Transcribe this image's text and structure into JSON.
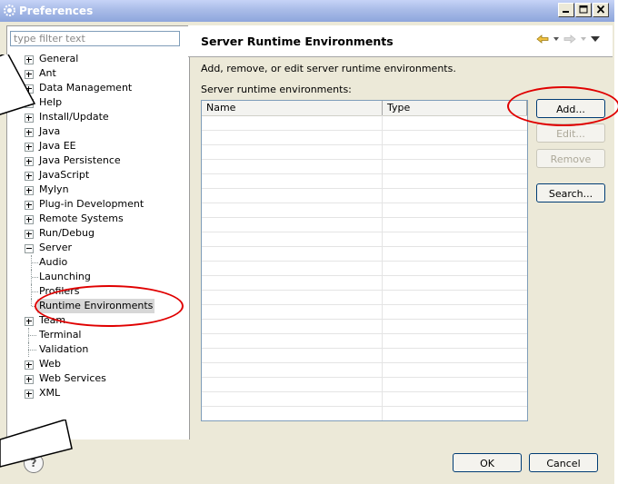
{
  "window": {
    "title": "Preferences",
    "controls": [
      "minimize",
      "maximize",
      "close"
    ]
  },
  "filter": {
    "placeholder": "type filter text"
  },
  "tree": [
    {
      "label": "General",
      "expandable": true
    },
    {
      "label": "Ant",
      "expandable": true
    },
    {
      "label": "Data Management",
      "expandable": true
    },
    {
      "label": "Help",
      "expandable": true
    },
    {
      "label": "Install/Update",
      "expandable": true
    },
    {
      "label": "Java",
      "expandable": true
    },
    {
      "label": "Java EE",
      "expandable": true
    },
    {
      "label": "Java Persistence",
      "expandable": true
    },
    {
      "label": "JavaScript",
      "expandable": true
    },
    {
      "label": "Mylyn",
      "expandable": true
    },
    {
      "label": "Plug-in Development",
      "expandable": true
    },
    {
      "label": "Remote Systems",
      "expandable": true
    },
    {
      "label": "Run/Debug",
      "expandable": true
    },
    {
      "label": "Server",
      "expandable": true,
      "expanded": true
    },
    {
      "label": "Audio",
      "child": true
    },
    {
      "label": "Launching",
      "child": true
    },
    {
      "label": "Profilers",
      "child": true
    },
    {
      "label": "Runtime Environments",
      "child": true,
      "selected": true
    },
    {
      "label": "Team",
      "expandable": true
    },
    {
      "label": "Terminal",
      "expandable": false
    },
    {
      "label": "Validation",
      "expandable": false
    },
    {
      "label": "Web",
      "expandable": true
    },
    {
      "label": "Web Services",
      "expandable": true
    },
    {
      "label": "XML",
      "expandable": true
    }
  ],
  "page": {
    "title": "Server Runtime Environments",
    "description": "Add, remove, or edit server runtime environments.",
    "table_label": "Server runtime environments:",
    "columns": [
      "Name",
      "Type"
    ]
  },
  "buttons": {
    "add": "Add...",
    "edit": "Edit...",
    "remove": "Remove",
    "search": "Search...",
    "ok": "OK",
    "cancel": "Cancel"
  },
  "help": {
    "glyph": "?"
  },
  "colors": {
    "annotation": "#e00000",
    "nav_arrow": "#f0c040"
  }
}
